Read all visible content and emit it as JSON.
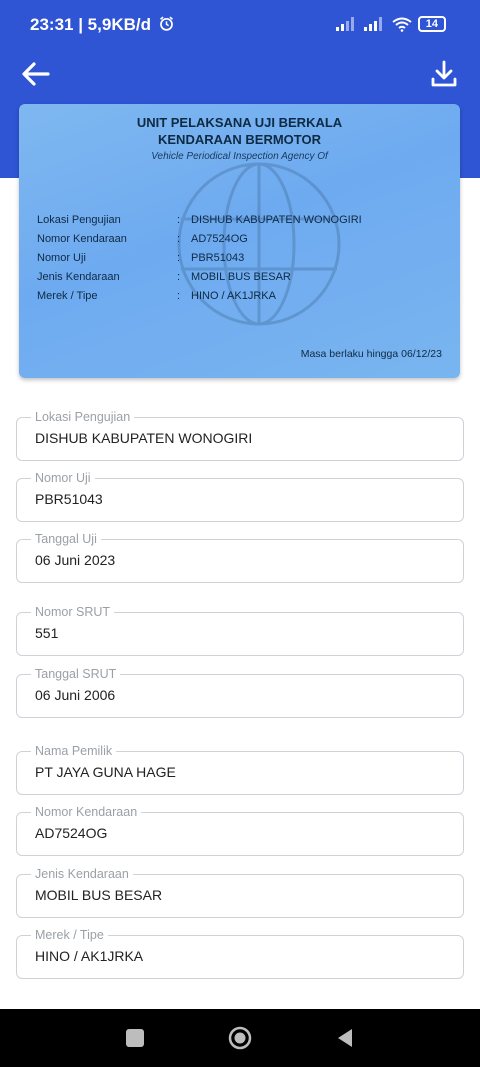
{
  "status_bar": {
    "time_speed": "23:31 | 5,9KB/d",
    "battery": "14",
    "icons": [
      "alarm-icon",
      "signal-icon",
      "signal-icon",
      "wifi-icon",
      "battery-icon"
    ]
  },
  "app_bar": {
    "back_icon": "arrow-left-icon",
    "download_icon": "download-icon"
  },
  "card": {
    "title_line1": "UNIT PELAKSANA UJI BERKALA",
    "title_line2": "KENDARAAN BERMOTOR",
    "subtitle": "Vehicle Periodical Inspection Agency Of",
    "rows": [
      {
        "key": "Lokasi Pengujian",
        "colon": ":",
        "value": "DISHUB KABUPATEN WONOGIRI"
      },
      {
        "key": "Nomor Kendaraan",
        "colon": ":",
        "value": "AD7524OG"
      },
      {
        "key": "Nomor Uji",
        "colon": ":",
        "value": "PBR51043"
      },
      {
        "key": "Jenis Kendaraan",
        "colon": ":",
        "value": "MOBIL  BUS BESAR"
      },
      {
        "key": "Merek / Tipe",
        "colon": ":",
        "value": "HINO / AK1JRKA"
      }
    ],
    "valid_until": "Masa berlaku hingga 06/12/23"
  },
  "fields": [
    {
      "label": "Lokasi Pengujian",
      "value": "DISHUB KABUPATEN WONOGIRI"
    },
    {
      "label": "Nomor Uji",
      "value": "PBR51043"
    },
    {
      "label": "Tanggal Uji",
      "value": "06 Juni 2023"
    },
    {
      "label": "Nomor SRUT",
      "value": "551"
    },
    {
      "label": "Tanggal SRUT",
      "value": "06 Juni 2006"
    },
    {
      "label": "Nama Pemilik",
      "value": "PT JAYA GUNA HAGE"
    },
    {
      "label": "Nomor Kendaraan",
      "value": "AD7524OG"
    },
    {
      "label": "Jenis Kendaraan",
      "value": "MOBIL  BUS BESAR"
    },
    {
      "label": "Merek / Tipe",
      "value": "HINO / AK1JRKA"
    }
  ],
  "nav_bar": {
    "icons": [
      "recents-square-icon",
      "home-circle-icon",
      "back-triangle-icon"
    ]
  },
  "colors": {
    "primary": "#2f55d4",
    "card": "#7fb8f0",
    "navbar": "#000000"
  }
}
